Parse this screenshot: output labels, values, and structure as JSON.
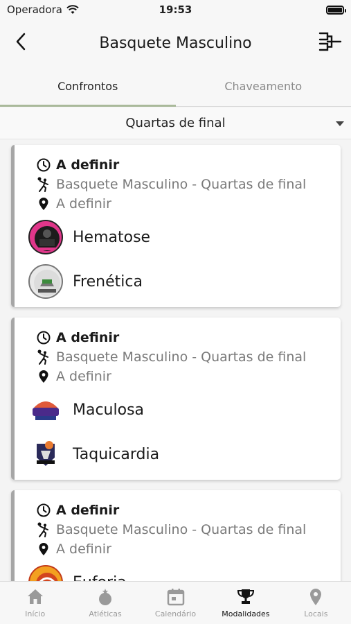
{
  "status": {
    "carrier": "Operadora",
    "time": "19:53"
  },
  "header": {
    "title": "Basquete Masculino"
  },
  "tabs": [
    {
      "label": "Confrontos"
    },
    {
      "label": "Chaveamento"
    }
  ],
  "phase_selector": {
    "value": "Quartas de final"
  },
  "matches": [
    {
      "time": "A definir",
      "sport": "Basquete Masculino - Quartas de final",
      "place": "A definir",
      "team1": "Hematose",
      "team2": "Frenética"
    },
    {
      "time": "A definir",
      "sport": "Basquete Masculino - Quartas de final",
      "place": "A definir",
      "team1": "Maculosa",
      "team2": "Taquicardia"
    },
    {
      "time": "A definir",
      "sport": "Basquete Masculino - Quartas de final",
      "place": "A definir",
      "team1": "Euforia"
    }
  ],
  "tabbar": [
    {
      "label": "Início",
      "icon": "home-icon"
    },
    {
      "label": "Atléticas",
      "icon": "medal-icon"
    },
    {
      "label": "Calendário",
      "icon": "calendar-icon"
    },
    {
      "label": "Modalidades",
      "icon": "trophy-icon"
    },
    {
      "label": "Locais",
      "icon": "map-pin-icon"
    }
  ],
  "colors": {
    "active_tab_underline": "#a9b99a",
    "card_stripe": "#a6a6a6",
    "tab_inactive": "#9a9a9a"
  }
}
